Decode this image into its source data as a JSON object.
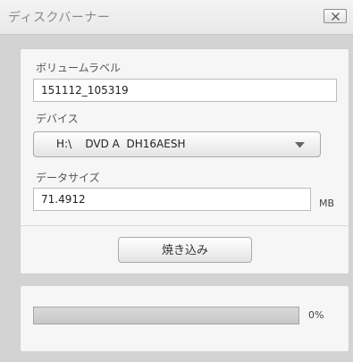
{
  "window": {
    "title": "ディスクバーナー",
    "close_icon": "close-icon"
  },
  "form": {
    "volume_label": {
      "label": "ボリュームラベル",
      "value": "151112_105319"
    },
    "device": {
      "label": "デバイス",
      "selected": "H:\\    DVD A  DH16AESH",
      "arrow_icon": "chevron-down-icon"
    },
    "data_size": {
      "label": "データサイズ",
      "value": "71.4912",
      "unit": "MB"
    },
    "burn_button": "焼き込み"
  },
  "progress": {
    "value": 0,
    "percent_text": "0%",
    "fill_color": "#5a8fd8"
  }
}
